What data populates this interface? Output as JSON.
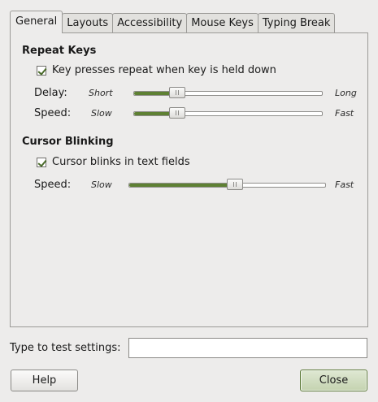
{
  "tabs": [
    {
      "label": "General",
      "active": true
    },
    {
      "label": "Layouts",
      "active": false
    },
    {
      "label": "Accessibility",
      "active": false
    },
    {
      "label": "Mouse Keys",
      "active": false
    },
    {
      "label": "Typing Break",
      "active": false
    }
  ],
  "repeat_keys": {
    "title": "Repeat Keys",
    "checkbox_label": "Key presses repeat when key is held down",
    "checked": true,
    "delay": {
      "label": "Delay:",
      "min_label": "Short",
      "max_label": "Long",
      "value": 0.23
    },
    "speed": {
      "label": "Speed:",
      "min_label": "Slow",
      "max_label": "Fast",
      "value": 0.23
    }
  },
  "cursor_blinking": {
    "title": "Cursor Blinking",
    "checkbox_label": "Cursor blinks in text fields",
    "checked": true,
    "speed": {
      "label": "Speed:",
      "min_label": "Slow",
      "max_label": "Fast",
      "value": 0.54
    }
  },
  "test": {
    "label": "Type to test settings:",
    "value": "",
    "placeholder": ""
  },
  "buttons": {
    "help": "Help",
    "close": "Close"
  },
  "colors": {
    "accent": "#5e8033",
    "background": "#edeceb"
  }
}
